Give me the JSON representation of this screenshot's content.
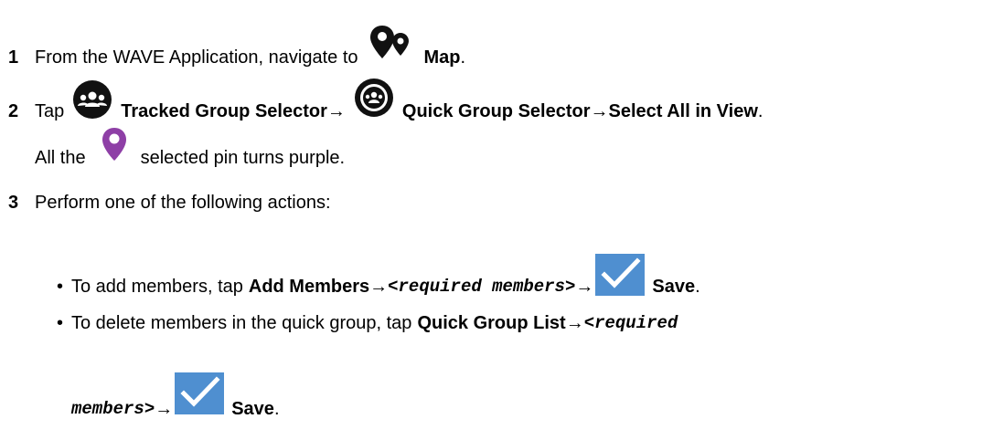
{
  "steps": [
    {
      "number": "1",
      "text_before": "From the WAVE Application, navigate to",
      "icon": "map-nav-icon",
      "bold_label": "Map",
      "end": "."
    },
    {
      "number": "2",
      "text_before": "Tap",
      "icon1": "tracked-group-selector-icon",
      "bold_1": "Tracked Group Selector",
      "arrow_1": "→",
      "icon2": "quick-group-selector-icon",
      "bold_2": "Quick Group Selector",
      "arrow_2": "→",
      "bold_3": "Select All in View",
      "end": ".",
      "note_before": "All the",
      "note_icon": "purple-pin-icon",
      "note_after": "selected pin turns purple."
    },
    {
      "number": "3",
      "text": "Perform one of the following actions:",
      "bullets": [
        {
          "bullet": "•",
          "text": "To add members, tap",
          "bold": "Add Members",
          "arrow1": "→",
          "code": "<required members>",
          "arrow2": "→",
          "icon": "checkmark-icon",
          "save": "Save",
          "end": "."
        },
        {
          "bullet": "•",
          "text": "To delete members in the quick group, tap",
          "bold": "Quick Group List",
          "arrow1": "→",
          "code_line1": "<required",
          "code_line2": "members>",
          "arrow2": "→",
          "icon": "checkmark-icon",
          "save": "Save",
          "end": "."
        }
      ]
    }
  ],
  "colors": {
    "pin_purple": "#8e3fa6",
    "check_blue": "#4f8fd0",
    "icon_black": "#111111"
  }
}
